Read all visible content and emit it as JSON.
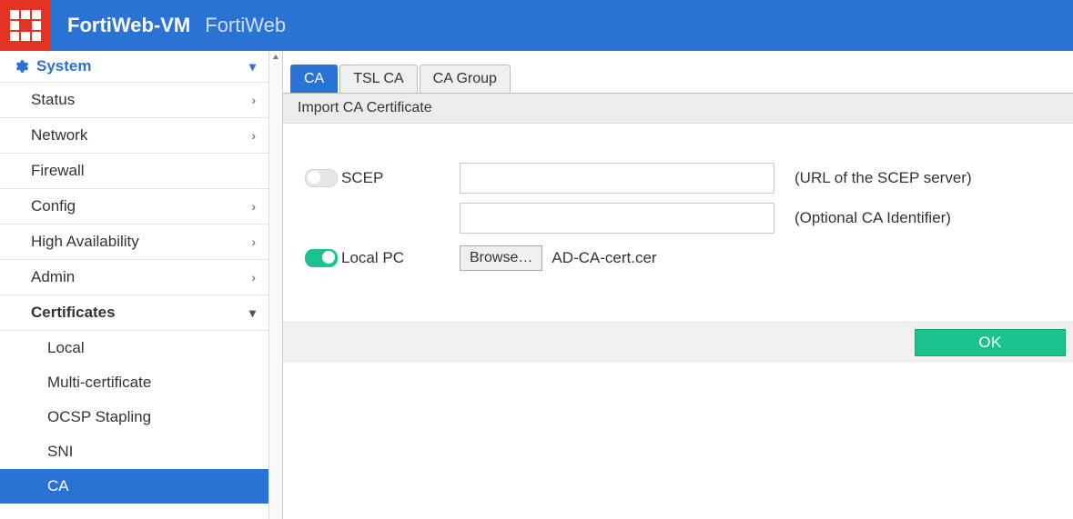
{
  "header": {
    "product": "FortiWeb-VM",
    "subtitle": "FortiWeb"
  },
  "sidebar": {
    "section": "System",
    "items": [
      {
        "label": "Status",
        "has_children": true
      },
      {
        "label": "Network",
        "has_children": true
      },
      {
        "label": "Firewall",
        "has_children": false
      },
      {
        "label": "Config",
        "has_children": true
      },
      {
        "label": "High Availability",
        "has_children": true
      },
      {
        "label": "Admin",
        "has_children": true
      }
    ],
    "cert_section": {
      "label": "Certificates"
    },
    "cert_children": [
      {
        "label": "Local"
      },
      {
        "label": "Multi-certificate"
      },
      {
        "label": "OCSP Stapling"
      },
      {
        "label": "SNI"
      },
      {
        "label": "CA"
      }
    ]
  },
  "tabs": [
    {
      "label": "CA"
    },
    {
      "label": "TSL CA"
    },
    {
      "label": "CA Group"
    }
  ],
  "page_subtitle": "Import CA Certificate",
  "form": {
    "scep": {
      "label": "SCEP",
      "url_value": "",
      "url_hint": "(URL of the SCEP server)",
      "id_value": "",
      "id_hint": "(Optional CA Identifier)"
    },
    "localpc": {
      "label": "Local PC",
      "browse_label": "Browse…",
      "file_name": "AD-CA-cert.cer"
    }
  },
  "buttons": {
    "ok": "OK"
  }
}
